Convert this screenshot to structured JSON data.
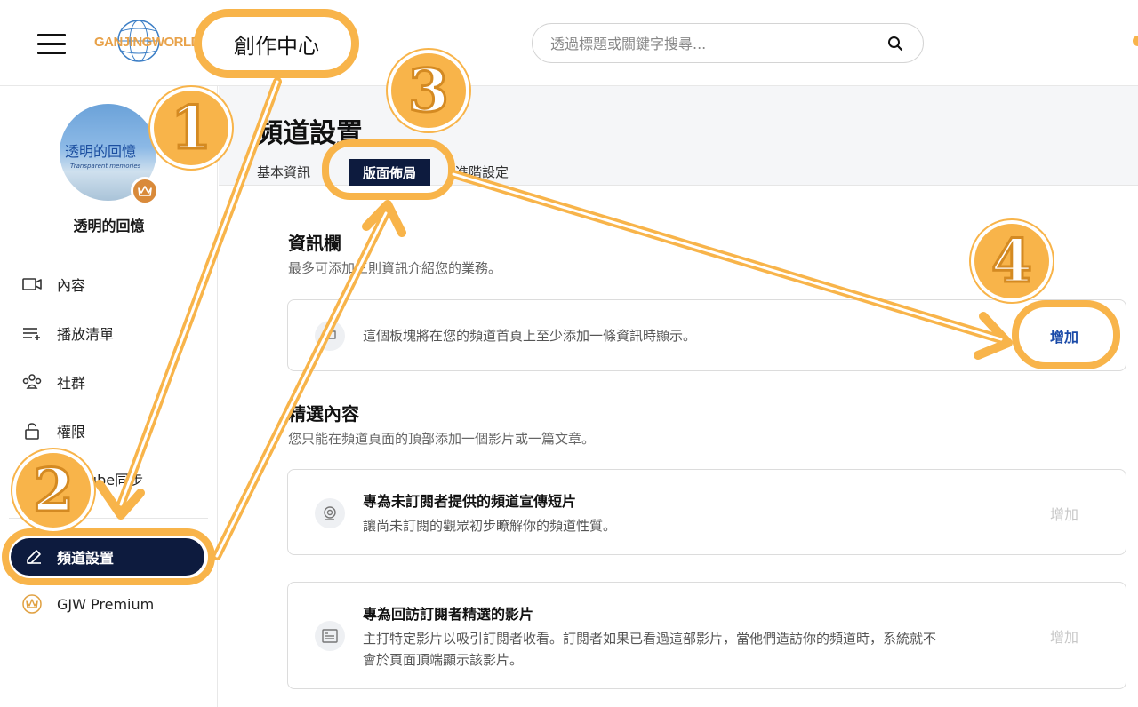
{
  "header": {
    "logo_text": "GANJINGWORLD",
    "creator_center_label": "創作中心",
    "search_placeholder": "透過標題或關鍵字搜尋..."
  },
  "sidebar": {
    "channel_name": "透明的回憶",
    "avatar_text": "透明的回憶",
    "avatar_subtext": "Transparent memories",
    "items": [
      {
        "label": "內容",
        "icon": "video-camera-icon"
      },
      {
        "label": "播放清單",
        "icon": "playlist-icon"
      },
      {
        "label": "社群",
        "icon": "community-icon"
      },
      {
        "label": "權限",
        "icon": "lock-icon"
      },
      {
        "label": "YouTube同步",
        "icon": "sync-icon"
      },
      {
        "label": "頻道設置",
        "icon": "pencil-icon",
        "active": true
      },
      {
        "label": "GJW Premium",
        "icon": "crown-icon"
      }
    ]
  },
  "main": {
    "page_title": "頻道設置",
    "tabs": [
      {
        "label": "基本資訊"
      },
      {
        "label": "版面佈局",
        "active": true
      },
      {
        "label": "進階設定"
      }
    ],
    "info_section": {
      "title": "資訊欄",
      "description": "最多可添加三則資訊介紹您的業務。",
      "card_text": "這個板塊將在您的頻道首頁上至少添加一條資訊時顯示。",
      "add_label": "增加"
    },
    "featured_section": {
      "title": "精選內容",
      "description": "您只能在頻道頁面的頂部添加一個影片或一篇文章。",
      "cards": [
        {
          "title": "專為未訂閱者提供的頻道宣傳短片",
          "description": "讓尚未訂閱的觀眾初步瞭解你的頻道性質。",
          "add_label": "增加"
        },
        {
          "title": "專為回訪訂閱者精選的影片",
          "description_line1": "主打特定影片以吸引訂閱者收看。訂閱者如果已看過這部影片，當他們造訪你的頻道時，系統就不",
          "description_line2": "會於頁面頂端顯示該影片。",
          "add_label": "增加"
        }
      ]
    }
  },
  "annotations": {
    "steps": [
      "1",
      "2",
      "3",
      "4"
    ],
    "highlight_color": "#f8b44a"
  }
}
